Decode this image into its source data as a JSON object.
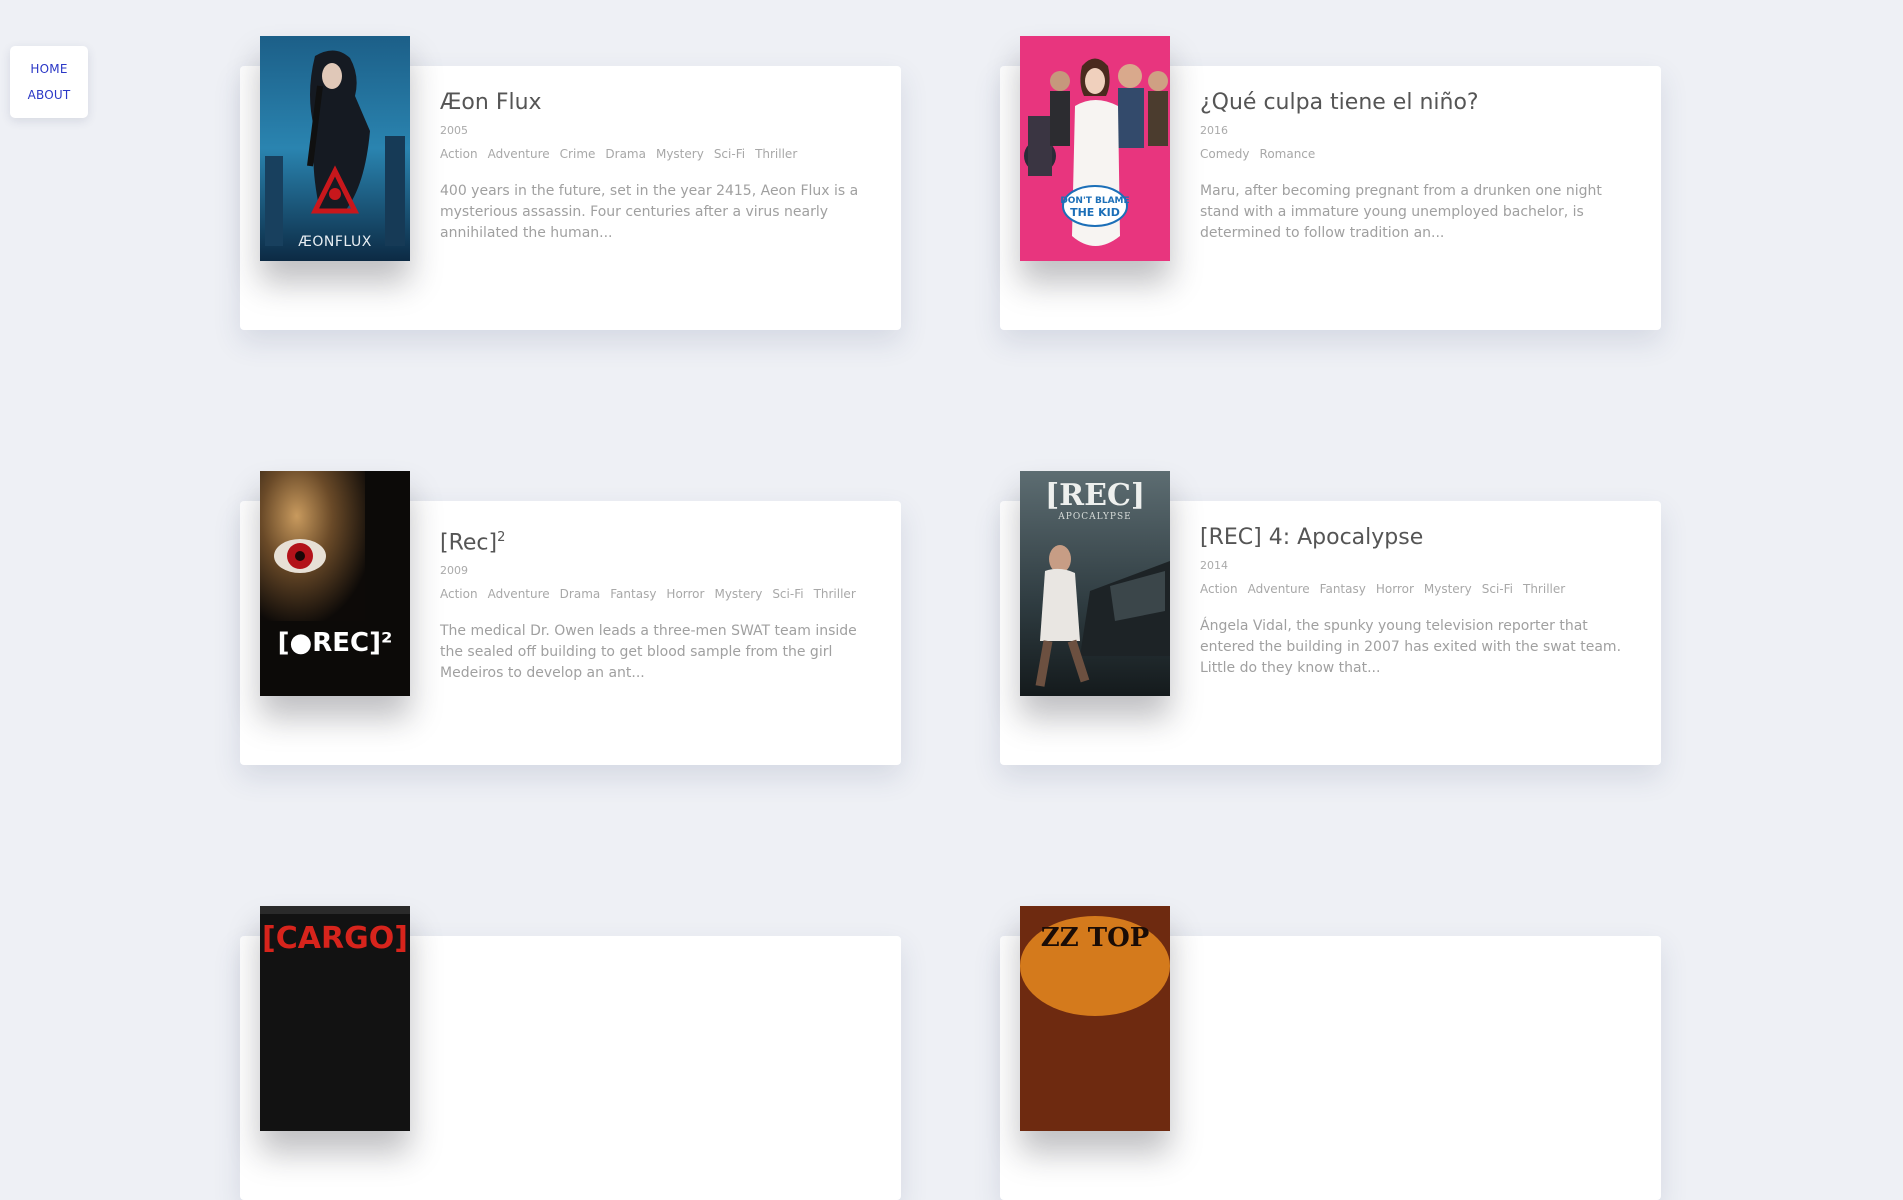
{
  "nav": {
    "home_label": "HOME",
    "about_label": "ABOUT"
  },
  "movies": [
    {
      "title": "Æon Flux",
      "year": "2005",
      "genres": [
        "Action",
        "Adventure",
        "Crime",
        "Drama",
        "Mystery",
        "Sci-Fi",
        "Thriller"
      ],
      "summary": "400 years in the future, set in the year 2415, Aeon Flux is a mysterious assassin. Four centuries after a virus nearly annihilated the human...",
      "poster_text": "ÆONFLUX"
    },
    {
      "title": "¿Qué culpa tiene el niño?",
      "year": "2016",
      "genres": [
        "Comedy",
        "Romance"
      ],
      "summary": "Maru, after becoming pregnant from a drunken one night stand with a immature young unemployed bachelor, is determined to follow tradition an...",
      "poster_text": "DON'T BLAME THE KID"
    },
    {
      "title": "[Rec]",
      "title_sup": "2",
      "year": "2009",
      "genres": [
        "Action",
        "Adventure",
        "Drama",
        "Fantasy",
        "Horror",
        "Mystery",
        "Sci-Fi",
        "Thriller"
      ],
      "summary": "The medical Dr. Owen leads a three-men SWAT team inside the sealed off building to get blood sample from the girl Medeiros to develop an ant...",
      "poster_text": "[●REC]²"
    },
    {
      "title": "[REC] 4: Apocalypse",
      "year": "2014",
      "genres": [
        "Action",
        "Adventure",
        "Fantasy",
        "Horror",
        "Mystery",
        "Sci-Fi",
        "Thriller"
      ],
      "summary": "Ángela Vidal, the spunky young television reporter that entered the building in 2007 has exited with the swat team. Little do they know that...",
      "poster_text": "[●REC]⁴ APOCALYPSE"
    },
    {
      "poster_text": "[CARGO]"
    },
    {
      "poster_text": "ZZ TOP"
    }
  ]
}
